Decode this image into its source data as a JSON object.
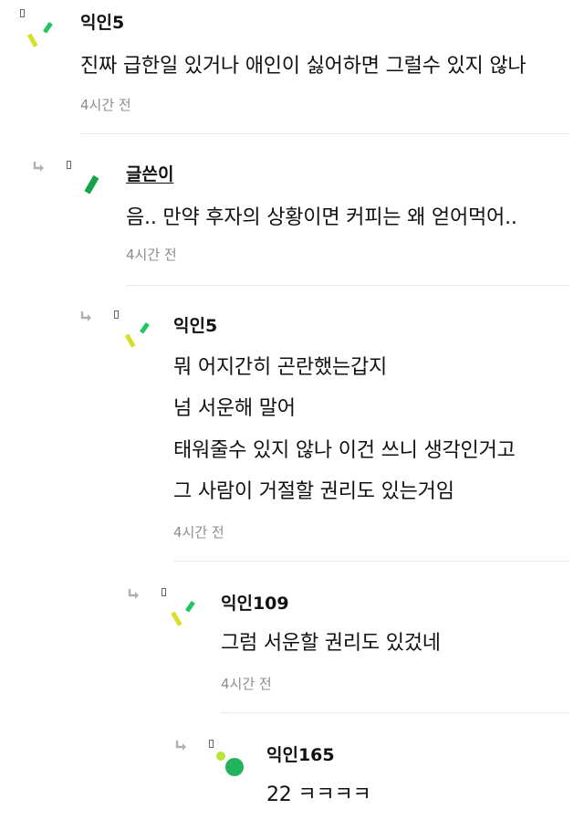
{
  "comments": [
    {
      "author": "익인5",
      "lines": [
        "진짜 급한일 있거나 애인이 싫어하면 그럴수 있지 않나"
      ],
      "time": "4시간 전"
    },
    {
      "author": "글쓴이",
      "lines": [
        "음.. 만약 후자의 상황이면 커피는 왜 얻어먹어.."
      ],
      "time": "4시간 전"
    },
    {
      "author": "익인5",
      "lines": [
        "뭐 어지간히 곤란했는갑지",
        "넘 서운해 말어",
        "태워줄수 있지 않나 이건 쓰니 생각인거고",
        "그 사람이 거절할 권리도 있는거임"
      ],
      "time": "4시간 전"
    },
    {
      "author": "익인109",
      "lines": [
        "그럼 서운할 권리도 있겄네"
      ],
      "time": "4시간 전"
    },
    {
      "author": "익인165",
      "lines": [
        "22 ㅋㅋㅋㅋ"
      ]
    }
  ],
  "colors": {
    "avatar_yellow": "#d4e02a",
    "avatar_green": "#22c55e",
    "avatar_dark_green": "#16a34a",
    "reply_arrow": "#b0b0b0",
    "time_text": "#8c8c8c"
  }
}
